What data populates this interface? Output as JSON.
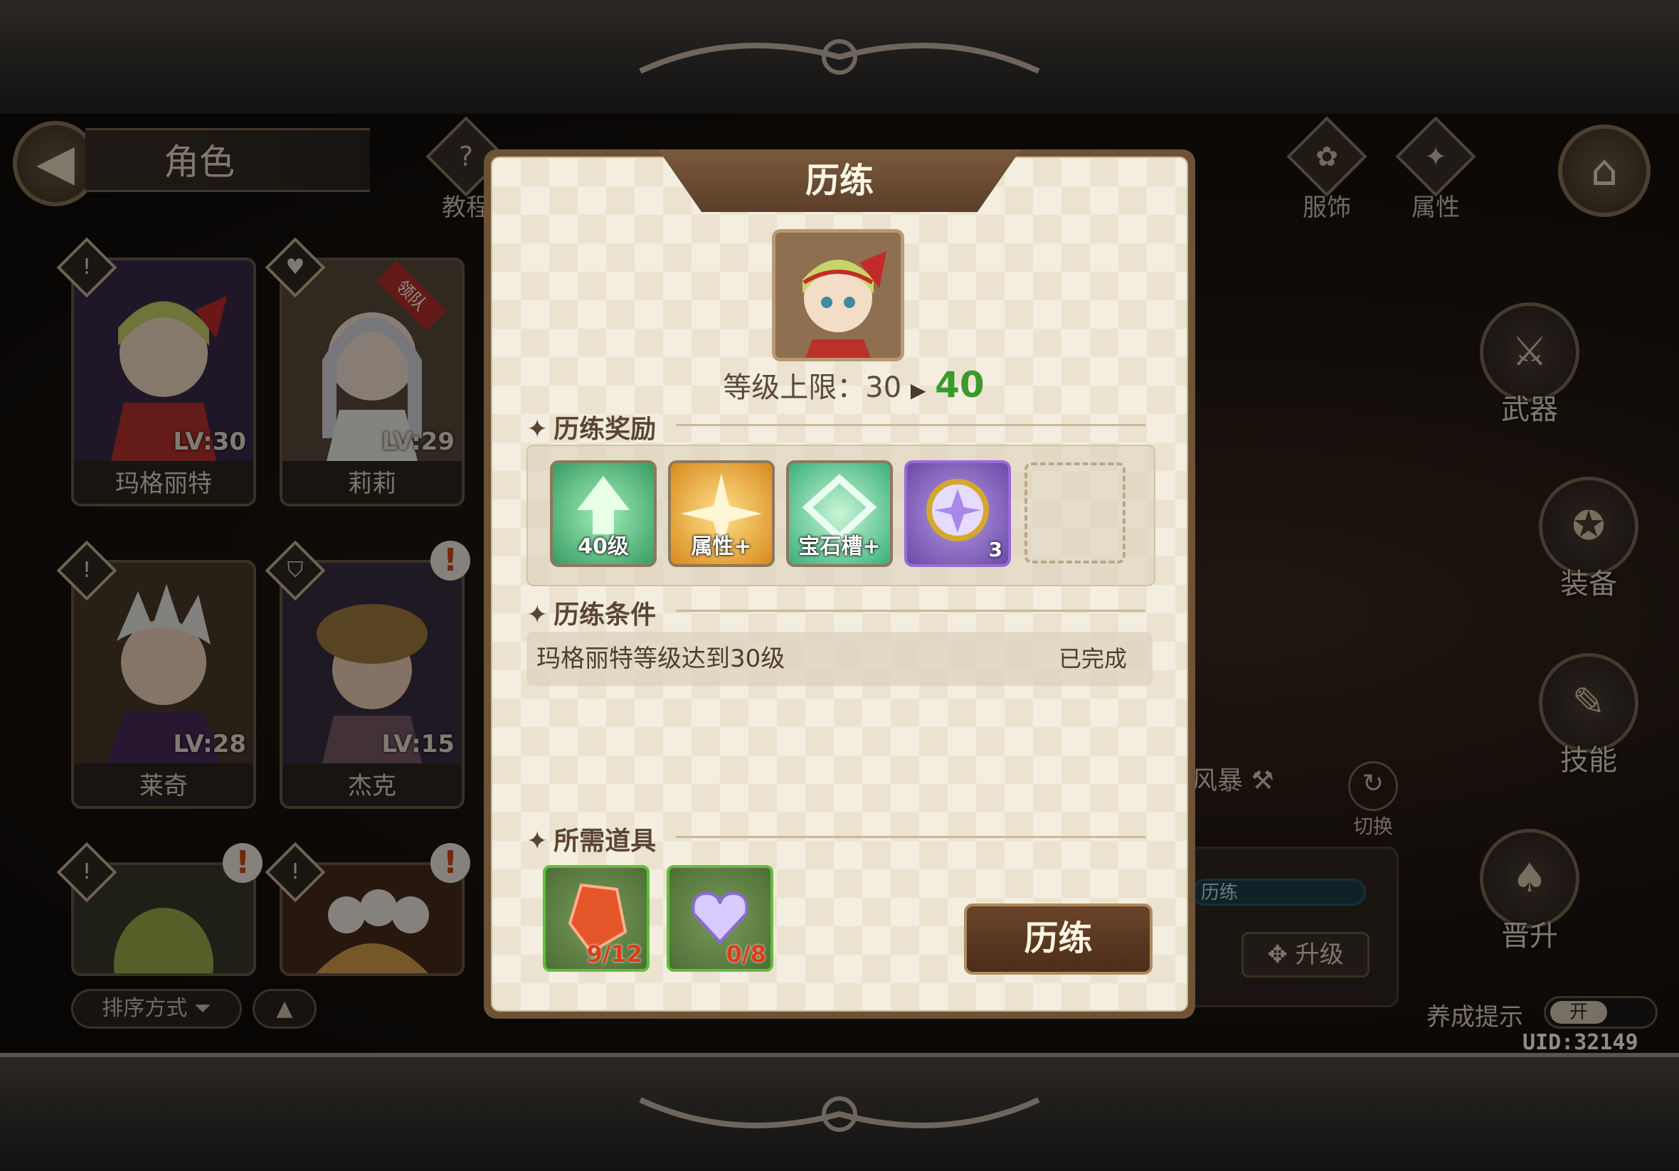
{
  "header": {
    "title": "角色",
    "tutorial_label": "教程"
  },
  "top_right": {
    "costume_label": "服饰",
    "attribute_label": "属性"
  },
  "characters": [
    {
      "name": "玛格丽特",
      "level": "LV:30"
    },
    {
      "name": "莉莉",
      "level": "LV:29",
      "tag": "领队"
    },
    {
      "name": "莱奇",
      "level": "LV:28"
    },
    {
      "name": "杰克",
      "level": "LV:15"
    },
    {
      "name": "",
      "level": ""
    },
    {
      "name": "",
      "level": ""
    }
  ],
  "list_controls": {
    "sort_label": "排序方式"
  },
  "side_menu": {
    "weapon": "武器",
    "equipment": "装备",
    "skill": "技能",
    "promote": "晋升"
  },
  "weapon_panel": {
    "weapon_name": "风暴",
    "switch_label": "切换",
    "bar_label": "历练",
    "upgrade_label": "升级"
  },
  "footer": {
    "hint_label": "养成提示",
    "hint_toggle": "开",
    "uid": "UID:32149"
  },
  "modal": {
    "title": "历练",
    "level_cap_label": "等级上限：",
    "level_current": "30",
    "level_new": "40",
    "rewards_title": "历练奖励",
    "rewards": [
      {
        "label": "40级",
        "type": "level-up",
        "color": "#4fc07a"
      },
      {
        "label": "属性+",
        "type": "attribute",
        "color": "#e8a02c"
      },
      {
        "label": "宝石槽+",
        "type": "gem-slot",
        "color": "#58c98c"
      },
      {
        "label": "",
        "count": "3",
        "type": "crystal",
        "color": "#8a6ac8"
      }
    ],
    "conditions_title": "历练条件",
    "condition_text": "玛格丽特等级达到30级",
    "condition_status": "已完成",
    "required_title": "所需道具",
    "required": [
      {
        "count": "9/12",
        "type": "red-gem"
      },
      {
        "count": "0/8",
        "type": "heart-crystal"
      }
    ],
    "confirm_label": "历练"
  }
}
